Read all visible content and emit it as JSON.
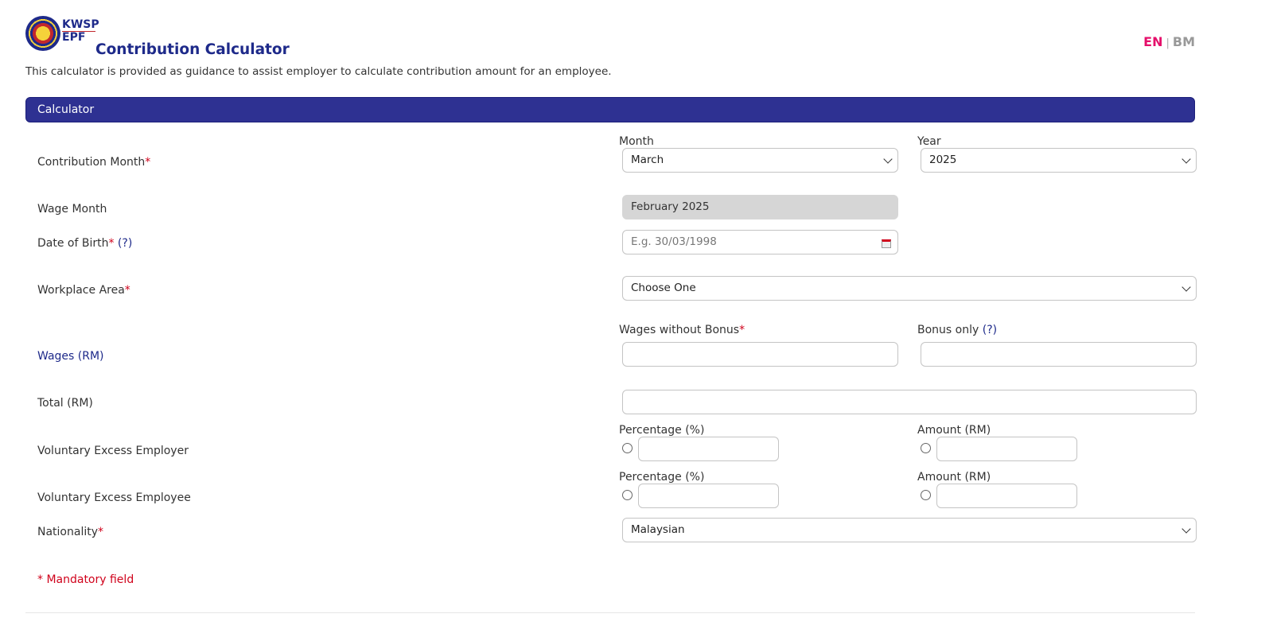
{
  "brand": {
    "line1": "KWSP",
    "line2": "EPF"
  },
  "page": {
    "title": "Contribution Calculator",
    "intro": "This calculator is provided as guidance to assist employer to calculate contribution amount for an employee."
  },
  "lang": {
    "en": "EN",
    "separator": "|",
    "bm": "BM"
  },
  "section": {
    "title": "Calculator"
  },
  "form": {
    "contribution_month": {
      "label": "Contribution Month",
      "required": "*",
      "month_label": "Month",
      "month_value": "March",
      "year_label": "Year",
      "year_value": "2025"
    },
    "wage_month": {
      "label": "Wage Month",
      "value": "February 2025"
    },
    "dob": {
      "label": "Date of Birth",
      "required": "*",
      "help": "(?)",
      "placeholder": "E.g. 30/03/1998"
    },
    "workplace": {
      "label": "Workplace Area",
      "required": "*",
      "value": "Choose One"
    },
    "wages": {
      "label": "Wages (RM)",
      "without_bonus_label": "Wages without Bonus",
      "required": "*",
      "bonus_label": "Bonus only",
      "bonus_help": "(?)"
    },
    "total": {
      "label": "Total (RM)"
    },
    "vol_employer": {
      "label": "Voluntary Excess Employer",
      "pct_label": "Percentage (%)",
      "amt_label": "Amount (RM)"
    },
    "vol_employee": {
      "label": "Voluntary Excess Employee",
      "pct_label": "Percentage (%)",
      "amt_label": "Amount (RM)"
    },
    "nationality": {
      "label": "Nationality",
      "required": "*",
      "value": "Malaysian"
    }
  },
  "footer": {
    "mandatory": "* Mandatory field"
  }
}
